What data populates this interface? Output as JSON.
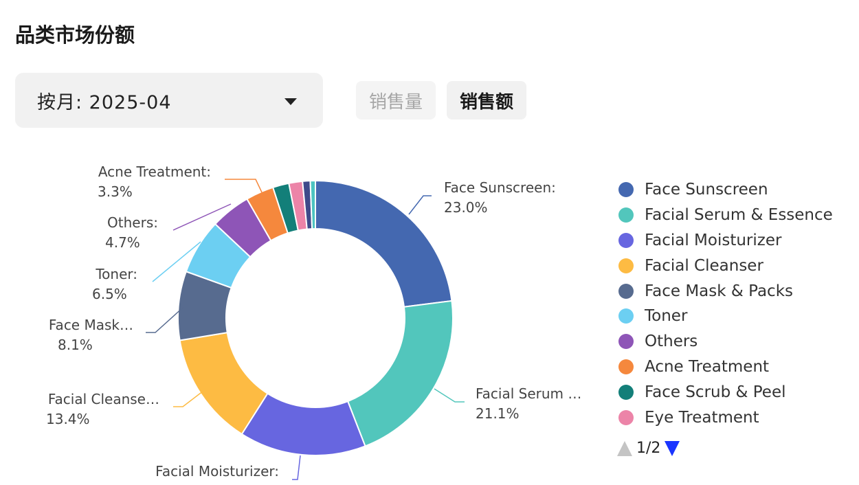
{
  "title": "品类市场份额",
  "month_select": {
    "value": "按月: 2025-04"
  },
  "metric_buttons": {
    "volume": "销售量",
    "amount": "销售额",
    "active": "amount"
  },
  "legend": {
    "page_text": "1/2"
  },
  "chart_data": {
    "type": "pie",
    "donut": true,
    "series": [
      {
        "name": "Face Sunscreen",
        "label": "Face Sunscreen:",
        "percent_text": "23.0%",
        "value": 23.0,
        "color": "#4468b0"
      },
      {
        "name": "Facial Serum & Essence",
        "label": "Facial Serum …",
        "percent_text": "21.1%",
        "value": 21.1,
        "color": "#52c6bc"
      },
      {
        "name": "Facial Moisturizer",
        "label": "Facial Moisturizer:",
        "percent_text": "",
        "value": 14.9,
        "color": "#6766e0"
      },
      {
        "name": "Facial Cleanser",
        "label": "Facial Cleanse…",
        "percent_text": "13.4%",
        "value": 13.4,
        "color": "#fdbb43"
      },
      {
        "name": "Face Mask & Packs",
        "label": "Face Mask…",
        "percent_text": "8.1%",
        "value": 8.1,
        "color": "#576b8f"
      },
      {
        "name": "Toner",
        "label": "Toner:",
        "percent_text": "6.5%",
        "value": 6.5,
        "color": "#6ccff2"
      },
      {
        "name": "Others",
        "label": "Others:",
        "percent_text": "4.7%",
        "value": 4.7,
        "color": "#8e55b7"
      },
      {
        "name": "Acne Treatment",
        "label": "Acne Treatment:",
        "percent_text": "3.3%",
        "value": 3.3,
        "color": "#f5883d"
      },
      {
        "name": "Face Scrub & Peel",
        "label": "",
        "percent_text": "",
        "value": 1.9,
        "color": "#137f79"
      },
      {
        "name": "Eye Treatment",
        "label": "",
        "percent_text": "",
        "value": 1.6,
        "color": "#ec84a8"
      },
      {
        "name": "",
        "label": "",
        "percent_text": "",
        "value": 0.9,
        "color": "#3f4a8a"
      },
      {
        "name": "",
        "label": "",
        "percent_text": "",
        "value": 0.6,
        "color": "#4cc4c1"
      }
    ],
    "legend_position": "right"
  }
}
